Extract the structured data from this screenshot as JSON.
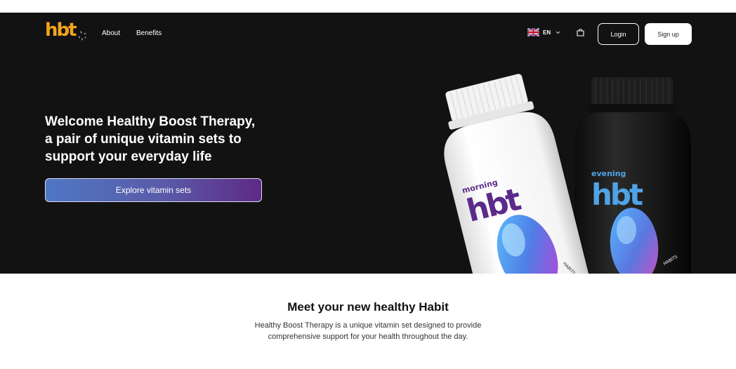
{
  "brand": {
    "logo_text": "hbt",
    "accent_color": "#f4a51c"
  },
  "nav": {
    "links": [
      "About",
      "Benefits"
    ],
    "language": {
      "code": "EN",
      "flag_icon": "uk-flag-icon"
    },
    "cart_icon": "shopping-bag-icon",
    "login_label": "Login",
    "signup_label": "Sign up"
  },
  "hero": {
    "headline_lines": [
      "Welcome Healthy Boost Therapy,",
      "a pair of unique vitamin sets to",
      "support your everyday life"
    ],
    "cta_label": "Explore vitamin sets",
    "background_color": "#121212",
    "bottles": [
      {
        "label_top": "morning",
        "label_main": "hbt",
        "ring_text": "HABITS",
        "color": "#ffffff"
      },
      {
        "label_top": "evening",
        "label_main": "hbt",
        "ring_text": "HABITS",
        "color": "#1a1a1a"
      }
    ]
  },
  "intro": {
    "title": "Meet your new healthy Habit",
    "description_lines": [
      "Healthy Boost Therapy is a unique vitamin set designed to provide",
      "comprehensive support for your health throughout the day."
    ]
  }
}
